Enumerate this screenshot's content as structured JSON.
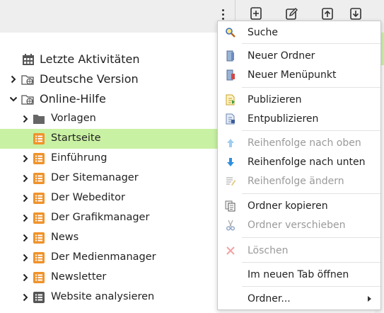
{
  "toolbar": {
    "icons": [
      "more-vertical-icon",
      "add-icon",
      "edit-icon",
      "upload-icon",
      "download-icon"
    ]
  },
  "tree": {
    "items": [
      {
        "label": "Letzte Aktivitäten",
        "icon": "calendar-icon",
        "expand": "none",
        "level": 0
      },
      {
        "label": "Deutsche Version",
        "icon": "globe-folder-icon",
        "expand": "collapsed",
        "level": 0
      },
      {
        "label": "Online-Hilfe",
        "icon": "globe-folder-icon",
        "expand": "expanded",
        "level": 0
      },
      {
        "label": "Vorlagen",
        "icon": "folder-icon",
        "expand": "collapsed",
        "level": 1
      },
      {
        "label": "Startseite",
        "icon": "page-icon",
        "expand": "none",
        "level": 1,
        "selected": true
      },
      {
        "label": "Einführung",
        "icon": "page-icon",
        "expand": "collapsed",
        "level": 1
      },
      {
        "label": "Der Sitemanager",
        "icon": "page-icon",
        "expand": "collapsed",
        "level": 1
      },
      {
        "label": "Der Webeditor",
        "icon": "page-icon",
        "expand": "collapsed",
        "level": 1
      },
      {
        "label": "Der Grafikmanager",
        "icon": "page-icon",
        "expand": "collapsed",
        "level": 1
      },
      {
        "label": "News",
        "icon": "page-icon",
        "expand": "collapsed",
        "level": 1
      },
      {
        "label": "Der Medienmanager",
        "icon": "page-icon",
        "expand": "collapsed",
        "level": 1
      },
      {
        "label": "Newsletter",
        "icon": "page-icon",
        "expand": "collapsed",
        "level": 1
      },
      {
        "label": "Website analysieren",
        "icon": "page-gray-icon",
        "expand": "collapsed",
        "level": 1
      }
    ]
  },
  "context_menu": {
    "items": [
      {
        "label": "Suche",
        "icon": "search-icon",
        "enabled": true
      },
      {
        "label": "Neuer Ordner",
        "icon": "new-folder-icon",
        "enabled": true
      },
      {
        "label": "Neuer Menüpunkt",
        "icon": "new-menu-item-icon",
        "enabled": true
      },
      {
        "label": "Publizieren",
        "icon": "publish-icon",
        "enabled": true
      },
      {
        "label": "Entpublizieren",
        "icon": "unpublish-icon",
        "enabled": true
      },
      {
        "label": "Reihenfolge nach oben",
        "icon": "arrow-up-icon",
        "enabled": false
      },
      {
        "label": "Reihenfolge nach unten",
        "icon": "arrow-down-icon",
        "enabled": true
      },
      {
        "label": "Reihenfolge ändern",
        "icon": "reorder-icon",
        "enabled": false
      },
      {
        "label": "Ordner kopieren",
        "icon": "copy-icon",
        "enabled": true
      },
      {
        "label": "Ordner verschieben",
        "icon": "cut-icon",
        "enabled": false
      },
      {
        "label": "Löschen",
        "icon": "delete-icon",
        "enabled": false
      },
      {
        "label": "Im neuen Tab öffnen",
        "icon": "",
        "enabled": true
      },
      {
        "label": "Ordner...",
        "icon": "",
        "enabled": true,
        "submenu": true
      }
    ]
  },
  "colors": {
    "selected_row": "#c9f1a3",
    "toolbar_bg": "#eeeeee",
    "page_icon_orange": "#f0932b",
    "disabled_text": "#9a9a9a"
  }
}
